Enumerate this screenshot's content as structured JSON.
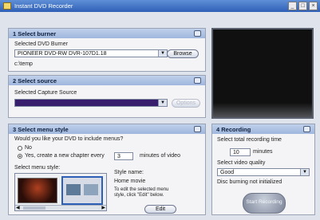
{
  "window": {
    "title": "Instant DVD Recorder",
    "buttons": [
      "_",
      "□",
      "×"
    ]
  },
  "burner": {
    "header": "1  Select burner",
    "label": "Selected DVD Burner",
    "value": "PIONEER DVD-RW  DVR-107D1.18",
    "browse_label": "Browse",
    "temp_path": "c:\\temp"
  },
  "source": {
    "header": "2  Select source",
    "label": "Selected Capture Source",
    "value": "",
    "options_label": "Options"
  },
  "menu": {
    "header": "3  Select menu style",
    "question": "Would you like your DVD to include menus?",
    "radio_no": "No",
    "radio_yes": "Yes, create a new chapter every",
    "chapter_minutes": "3",
    "minutes_suffix": "minutes of video",
    "style_label": "Select menu style:",
    "style_name_label": "Style name:",
    "style_name": "Home movie",
    "edit_hint": "To edit the selected menu style, click \"Edit\" below.",
    "edit_label": "Edit"
  },
  "recording": {
    "header": "4  Recording",
    "time_label": "Select total recording time",
    "time_value": "10",
    "time_unit": "minutes",
    "quality_label": "Select video quality",
    "quality_value": "Good",
    "status": "Disc burning not initialized",
    "start_label": "Start Recording"
  },
  "colors": {
    "accent": "#2e5fb6",
    "panel_header": "#a9bde0",
    "disabled_text": "#b4b8c2"
  }
}
